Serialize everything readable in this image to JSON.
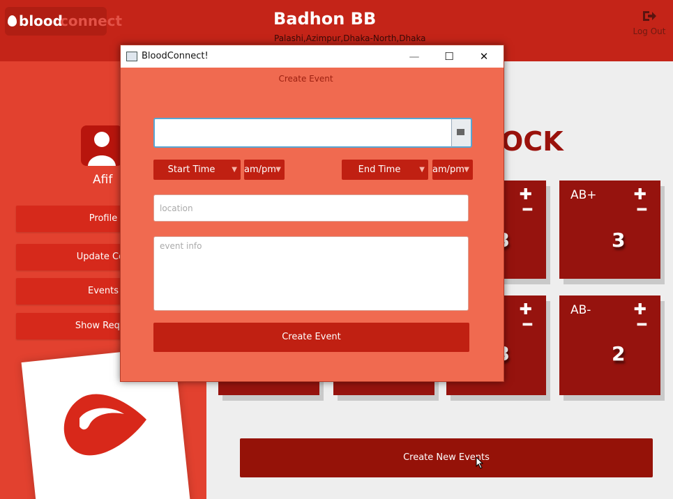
{
  "header": {
    "logo_part1": "blood",
    "logo_part2": "connect",
    "title": "Badhon BB",
    "address": "Palashi,Azimpur,Dhaka-North,Dhaka",
    "logout_label": "Log Out"
  },
  "sidebar": {
    "user_name": "Afif",
    "items": [
      {
        "label": "Profile"
      },
      {
        "label": "Update Cou"
      },
      {
        "label": "Events"
      },
      {
        "label": "Show Reque"
      }
    ]
  },
  "main": {
    "stock_title_fragment": "OCK",
    "tiles": [
      {
        "type": "",
        "count": "3"
      },
      {
        "type": "AB+",
        "count": "3"
      },
      {
        "type": "",
        "count": "3"
      },
      {
        "type": "AB-",
        "count": "2"
      }
    ],
    "create_new_events_label": "Create New Events"
  },
  "dialog": {
    "window_title": "BloodConnect!",
    "heading": "Create Event",
    "date_value": "",
    "start_time_label": "Start Time",
    "start_ampm_label": "am/pm",
    "end_time_label": "End Time",
    "end_ampm_label": "am/pm",
    "location_placeholder": "location",
    "event_info_placeholder": "event info",
    "create_button_label": "Create Event",
    "minimize": "—",
    "maximize": "☐",
    "close": "✕"
  },
  "colors": {
    "header": "#c42418",
    "sidebar": "#e2412f",
    "dialog_bg": "#f06a50",
    "button": "#c02012",
    "tile": "#96130e"
  },
  "icons": [
    "logout-icon",
    "avatar-icon",
    "calendar-icon",
    "plus-icon",
    "minus-icon",
    "chevron-down-icon",
    "blood-drop-icon"
  ]
}
